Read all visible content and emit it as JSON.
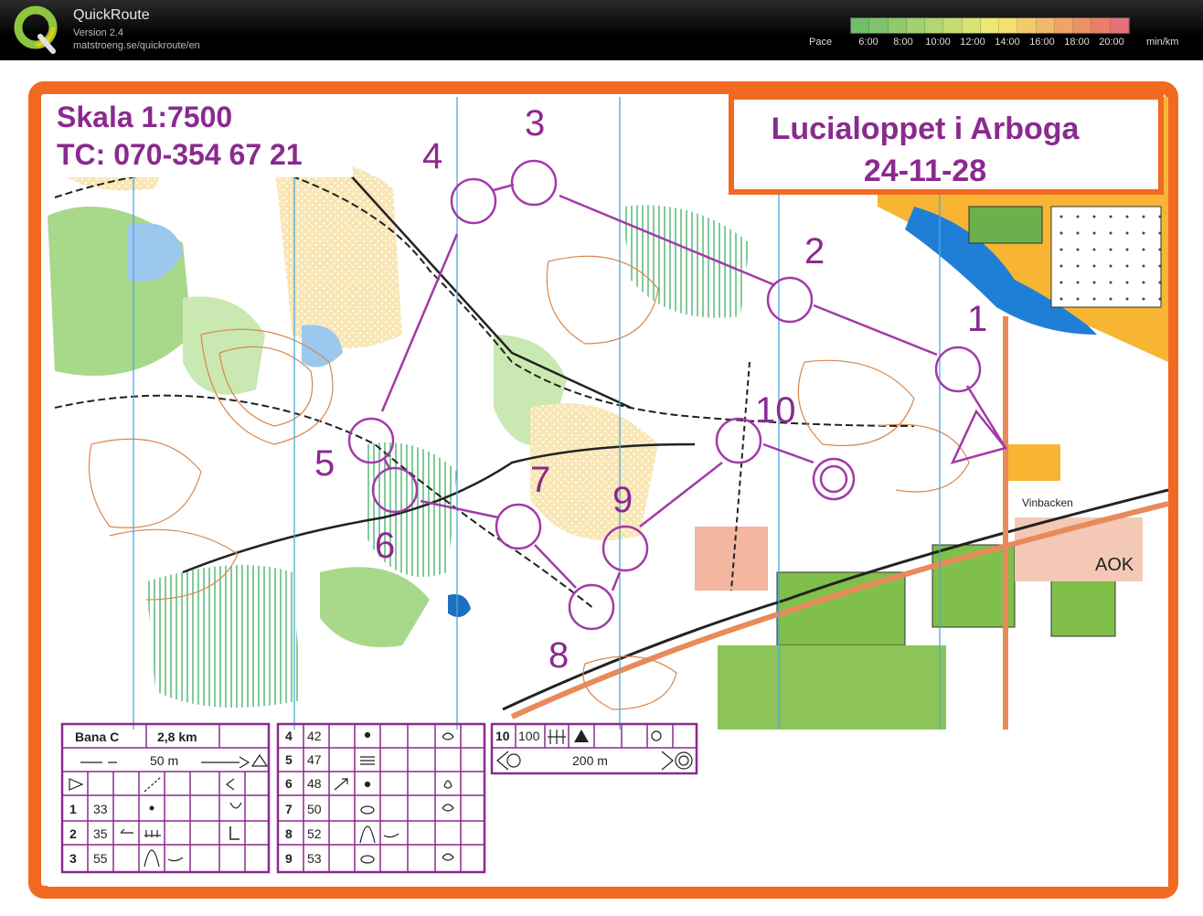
{
  "app": {
    "name": "QuickRoute",
    "version": "Version 2.4",
    "url": "matstroeng.se/quickroute/en"
  },
  "pace": {
    "label": "Pace",
    "ticks": [
      "6:00",
      "8:00",
      "10:00",
      "12:00",
      "14:00",
      "16:00",
      "18:00",
      "20:00"
    ],
    "unit": "min/km",
    "colors": [
      "#6fbf6a",
      "#7fc46c",
      "#8fca6d",
      "#a1d06f",
      "#b3d670",
      "#c6dc72",
      "#d9e274",
      "#ece876",
      "#f4e070",
      "#f2cc6c",
      "#f0b869",
      "#eea467",
      "#ec9066",
      "#ea7e6a",
      "#e8707a"
    ]
  },
  "map": {
    "scale_text": "Skala 1:7500",
    "phone_text": "TC: 070-354 67 21",
    "event_title": "Lucialoppet i Arboga",
    "event_date": "24-11-28",
    "place_label": "Vinbacken",
    "club_label": "AOK",
    "controls": [
      "1",
      "2",
      "3",
      "4",
      "5",
      "6",
      "7",
      "8",
      "9",
      "10"
    ],
    "colors": {
      "border": "#f26a22",
      "course": "#a23aa8",
      "text": "#8a2a8f",
      "forest_green": "#7cbf5a",
      "open_yellow": "#f6e0a0",
      "water": "#3f8fd8",
      "road_orange": "#f6a623"
    }
  },
  "description": {
    "course": "Bana C",
    "length": "2,8 km",
    "start_distance": "50 m",
    "finish_distance": "200 m",
    "controls_a": [
      {
        "n": "1",
        "code": "33"
      },
      {
        "n": "2",
        "code": "35"
      },
      {
        "n": "3",
        "code": "55"
      }
    ],
    "controls_b": [
      {
        "n": "4",
        "code": "42"
      },
      {
        "n": "5",
        "code": "47"
      },
      {
        "n": "6",
        "code": "48"
      },
      {
        "n": "7",
        "code": "50"
      },
      {
        "n": "8",
        "code": "52"
      },
      {
        "n": "9",
        "code": "53"
      }
    ],
    "last": {
      "n": "10",
      "code": "100"
    }
  }
}
